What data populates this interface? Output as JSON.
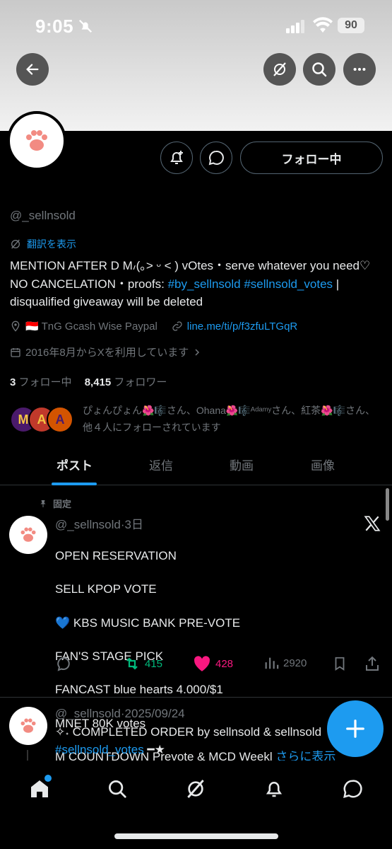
{
  "status_bar": {
    "time": "9:05",
    "battery": "90"
  },
  "colors": {
    "accent": "#1d9bf0",
    "like": "#f91880",
    "repost": "#00ba7c",
    "muted": "#71767b",
    "text": "#e7e9ea"
  },
  "icons": {
    "back": "back-arrow-icon",
    "grok": "grok-icon",
    "search": "search-icon",
    "more": "more-icon",
    "notify": "bell-plus-icon",
    "message": "message-icon"
  },
  "profile": {
    "follow_button": "フォロー中",
    "handle": "@_sellnsold",
    "translate": "翻訳を表示",
    "bio_plain_1": "MENTION AFTER D M៸(｡˃ ᵕ ˂ ) vOtes・serve whatever you need♡ NO CANCELATION・proofs: ",
    "bio_link_1": "#by_sellnsold",
    "bio_link_2": "#sellnsold_votes",
    "bio_plain_2": " | disqualified giveaway will be deleted",
    "location": "🇮🇩 TnG Gcash Wise Paypal",
    "website": "line.me/ti/p/f3zfuLTGqR",
    "joined": "2016年8月からXを利用しています",
    "following_count": "3",
    "following_label": "フォロー中",
    "followers_count": "8,415",
    "followers_label": "フォロワー",
    "mutuals_text": "ぴょんぴょん🌺🎼さん、Ohana🌺🎼ᴬᵈᵃᵐʸさん、紅茶🌺🎼さん、他４人にフォローされています",
    "mutual_avatars": [
      "M",
      "A",
      "A"
    ]
  },
  "tabs": [
    {
      "label": "ポスト",
      "active": true
    },
    {
      "label": "返信",
      "active": false
    },
    {
      "label": "動画",
      "active": false
    },
    {
      "label": "画像",
      "active": false
    }
  ],
  "post1": {
    "pinned_label": "固定",
    "author": "@_sellnsold",
    "time": "3日",
    "lines": [
      "OPEN RESERVATION",
      "SELL KPOP VOTE",
      "💙 KBS MUSIC BANK PRE-VOTE",
      "FAN'S STAGE PICK",
      "FANCAST blue hearts 4.000/$1",
      "MNET 80K votes"
    ],
    "last_line": "M COUNTDOWN Prevote & MCD Weekl",
    "show_more": "さらに表示",
    "reposts": "415",
    "likes": "428",
    "views": "2920"
  },
  "post2": {
    "author": "@_sellnsold",
    "time": "2025/09/24",
    "line1": "✧˖ COMPLETED ORDER by sellnsold & sellnsold",
    "line2_link": "#sellnsold_votes",
    "line2_tail": " ━★"
  }
}
